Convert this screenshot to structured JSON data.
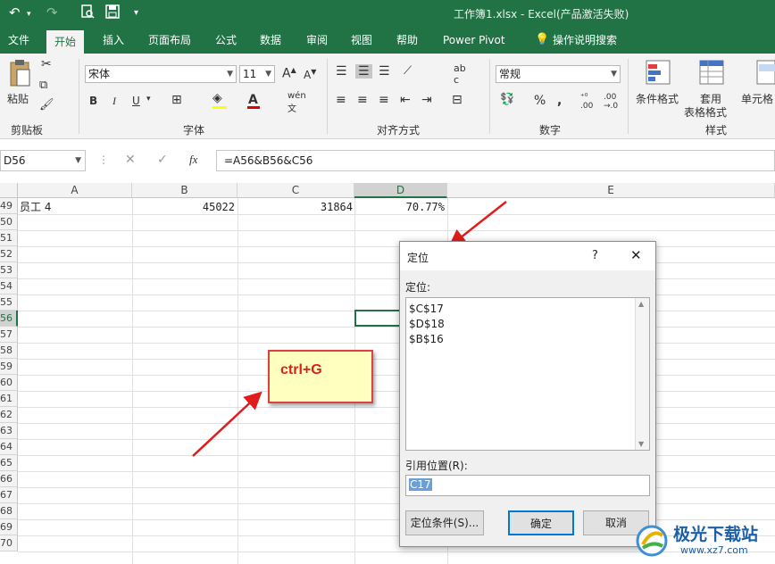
{
  "titlebar": {
    "title": "工作簿1.xlsx  -  Excel(产品激活失败)",
    "undo": "↶",
    "redo": "↷",
    "save": "💾",
    "more": "▾"
  },
  "tabs": [
    "文件",
    "开始",
    "插入",
    "页面布局",
    "公式",
    "数据",
    "审阅",
    "视图",
    "帮助",
    "Power Pivot",
    "操作说明搜索"
  ],
  "ribbon": {
    "clipboard": {
      "label": "剪贴板",
      "paste": "粘贴"
    },
    "font": {
      "label": "字体",
      "name": "宋体",
      "size": "11"
    },
    "align": {
      "label": "对齐方式"
    },
    "number": {
      "label": "数字",
      "format": "常规"
    },
    "styles": {
      "label": "样式",
      "cond": "条件格式",
      "table1": "套用",
      "table2": "表格格式",
      "cell": "单元格"
    }
  },
  "formula": {
    "namebox": "D56",
    "fx": "fx",
    "content": "=A56&B56&C56"
  },
  "columns": [
    "A",
    "B",
    "C",
    "D",
    "E"
  ],
  "rows": [
    "49",
    "50",
    "51",
    "52",
    "53",
    "54",
    "55",
    "56",
    "57",
    "58",
    "59",
    "60",
    "61",
    "62",
    "63",
    "64",
    "65",
    "66",
    "67",
    "68",
    "69",
    "70"
  ],
  "row49": {
    "a": "员工 4",
    "b": "45022",
    "c": "31864",
    "d": "70.77%"
  },
  "dialog": {
    "title": "定位",
    "help": "?",
    "close": "✕",
    "list_label": "定位:",
    "list_items": [
      "$C$17",
      "$D$18",
      "$B$16"
    ],
    "ref_label": "引用位置(R):",
    "ref_value": "C17",
    "special_btn": "定位条件(S)...",
    "ok_btn": "确定",
    "cancel_btn": "取消"
  },
  "annotation": {
    "text": "ctrl+G",
    "color": "#e01c1c"
  },
  "watermark": {
    "text": "极光下载站",
    "url": "www.xz7.com"
  },
  "colors": {
    "excel_green": "#217346",
    "arrow": "#e01c1c",
    "selection": "#217346"
  }
}
